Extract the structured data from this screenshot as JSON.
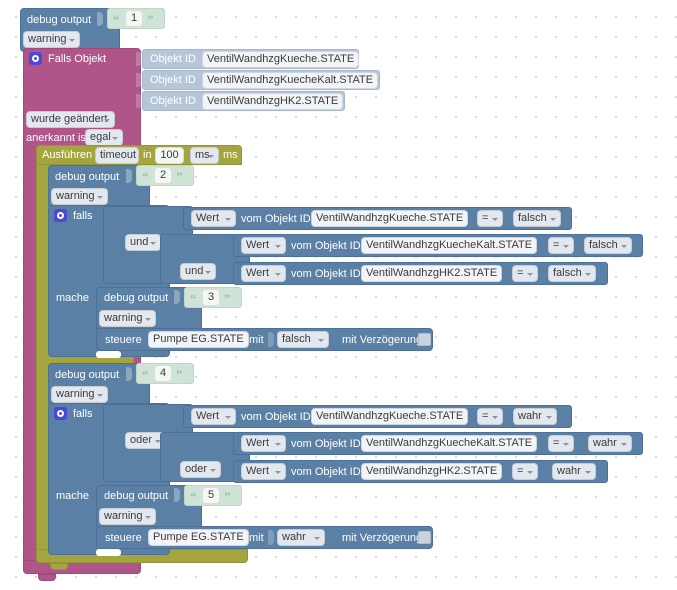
{
  "app": {
    "kind": "blockly-workspace",
    "language": "de"
  },
  "colors": {
    "blue": "#5b80a5",
    "pink": "#b0558a",
    "olive": "#a5a53f",
    "mint": "#cfe3d6",
    "light_blue": "#b6c6d8",
    "gear": "#4b49d6",
    "background": "#ffffff",
    "grid_dot": "#d8d8e0"
  },
  "labels": {
    "debug_output": "debug output",
    "warning": "warning",
    "falls_objekt": "Falls Objekt",
    "objekt_id": "Objekt ID",
    "wurde_geaendert": "wurde geändert",
    "anerkannt_ist": "anerkannt ist",
    "egal": "egal",
    "ausfuehren": "Ausführen",
    "timeout": "timeout",
    "in": "in",
    "ms_unit": "ms",
    "ms_suffix": "ms",
    "falls": "falls",
    "mache": "mache",
    "und": "und",
    "oder": "oder",
    "wert": "Wert",
    "vom_objekt_id": "vom Objekt ID",
    "equals": "=",
    "falsch": "falsch",
    "wahr": "wahr",
    "steuere": "steuere",
    "mit": "mit",
    "mit_verzoegerung": "mit Verzögerung"
  },
  "objects": {
    "ventil_kueche": "VentilWandhzgKueche.STATE",
    "ventil_kueche_kalt": "VentilWandhzgKuecheKalt.STATE",
    "ventil_hk2": "VentilWandhzgHK2.STATE",
    "pumpe_eg": "Pumpe EG.STATE"
  },
  "values": {
    "delay": "100",
    "debug_1": "1",
    "debug_2": "2",
    "debug_3": "3",
    "debug_4": "4",
    "debug_5": "5"
  },
  "quotes": {
    "open": "“",
    "close": "”"
  },
  "program": {
    "trigger": {
      "type": "Falls Objekt",
      "object_ids": [
        "VentilWandhzgKueche.STATE",
        "VentilWandhzgKuecheKalt.STATE",
        "VentilWandhzgHK2.STATE"
      ],
      "condition": "wurde geändert",
      "ack": "egal"
    },
    "timeout": {
      "name": "timeout",
      "value": "100",
      "unit": "ms"
    },
    "branch_off": {
      "operator": "und",
      "comparisons": [
        {
          "left": "VentilWandhzgKueche.STATE",
          "op": "=",
          "right": "falsch"
        },
        {
          "left": "VentilWandhzgKuecheKalt.STATE",
          "op": "=",
          "right": "falsch"
        },
        {
          "left": "VentilWandhzgHK2.STATE",
          "op": "=",
          "right": "falsch"
        }
      ],
      "action": {
        "target": "Pumpe EG.STATE",
        "value": "falsch",
        "debug": "3"
      }
    },
    "branch_on": {
      "operator": "oder",
      "comparisons": [
        {
          "left": "VentilWandhzgKueche.STATE",
          "op": "=",
          "right": "wahr"
        },
        {
          "left": "VentilWandhzgKuecheKalt.STATE",
          "op": "=",
          "right": "wahr"
        },
        {
          "left": "VentilWandhzgHK2.STATE",
          "op": "=",
          "right": "wahr"
        }
      ],
      "action": {
        "target": "Pumpe EG.STATE",
        "value": "wahr",
        "debug": "5"
      }
    }
  }
}
